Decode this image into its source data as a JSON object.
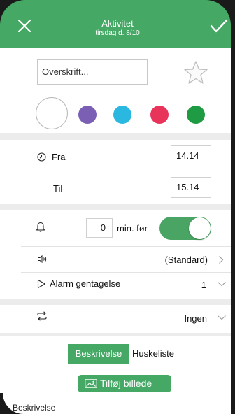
{
  "header": {
    "title": "Aktivitet",
    "subtitle": "tirsdag d. 8/10",
    "close_icon": "close-icon",
    "confirm_icon": "checkmark-icon",
    "color": "#45a865"
  },
  "title_field": {
    "placeholder": "Overskrift...",
    "value": ""
  },
  "favorite_icon": "star-icon",
  "colors": {
    "options": [
      "#ffffff",
      "#7a5fb5",
      "#2ab8e0",
      "#e8335a",
      "#1f9b43"
    ]
  },
  "time": {
    "from_label": "Fra",
    "from_value": "14.14",
    "to_label": "Til",
    "to_value": "15.14"
  },
  "reminder": {
    "minutes": "0",
    "unit_label": "min. før",
    "enabled": true
  },
  "sound": {
    "value": "(Standard)"
  },
  "alarm_repeat": {
    "label": "Alarm gentagelse",
    "value": "1"
  },
  "recurrence": {
    "value": "Ingen"
  },
  "tabs": {
    "description": "Beskrivelse",
    "checklist": "Huskeliste",
    "active": "description"
  },
  "add_photo": {
    "label": "Tilføj billede"
  },
  "description": {
    "label": "Beskrivelse"
  }
}
